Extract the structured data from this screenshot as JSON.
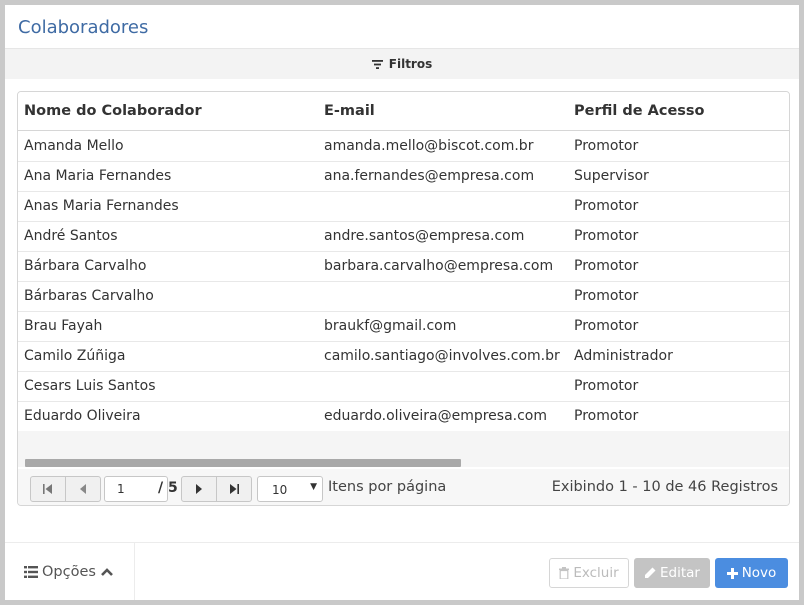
{
  "header": {
    "title": "Colaboradores"
  },
  "filter": {
    "label": "Filtros"
  },
  "grid": {
    "columns": [
      "Nome do Colaborador",
      "E-mail",
      "Perfil de Acesso"
    ],
    "rows": [
      [
        "Amanda Mello",
        "amanda.mello@biscot.com.br",
        "Promotor"
      ],
      [
        "Ana Maria Fernandes",
        "ana.fernandes@empresa.com",
        "Supervisor"
      ],
      [
        "Anas Maria Fernandes",
        "",
        "Promotor"
      ],
      [
        "André Santos",
        "andre.santos@empresa.com",
        "Promotor"
      ],
      [
        "Bárbara Carvalho",
        "barbara.carvalho@empresa.com",
        "Promotor"
      ],
      [
        "Bárbaras Carvalho",
        "",
        "Promotor"
      ],
      [
        "Brau Fayah",
        "braukf@gmail.com",
        "Promotor"
      ],
      [
        "Camilo Zúñiga",
        "camilo.santiago@involves.com.br",
        "Administrador"
      ],
      [
        "Cesars Luis Santos",
        "",
        "Promotor"
      ],
      [
        "Eduardo Oliveira",
        "eduardo.oliveira@empresa.com",
        "Promotor"
      ]
    ]
  },
  "pager": {
    "page": "1",
    "total_pages": "/ 5",
    "page_size": "10",
    "per_page_label": "Itens por página",
    "showing": "Exibindo 1 - 10 de 46 Registros"
  },
  "footer": {
    "options_label": "Opções",
    "delete_label": "Excluir",
    "edit_label": "Editar",
    "new_label": "Novo"
  },
  "colors": {
    "title": "#3f6ba4",
    "primary": "#4b8de0",
    "disabled": "#c4c4c4"
  }
}
